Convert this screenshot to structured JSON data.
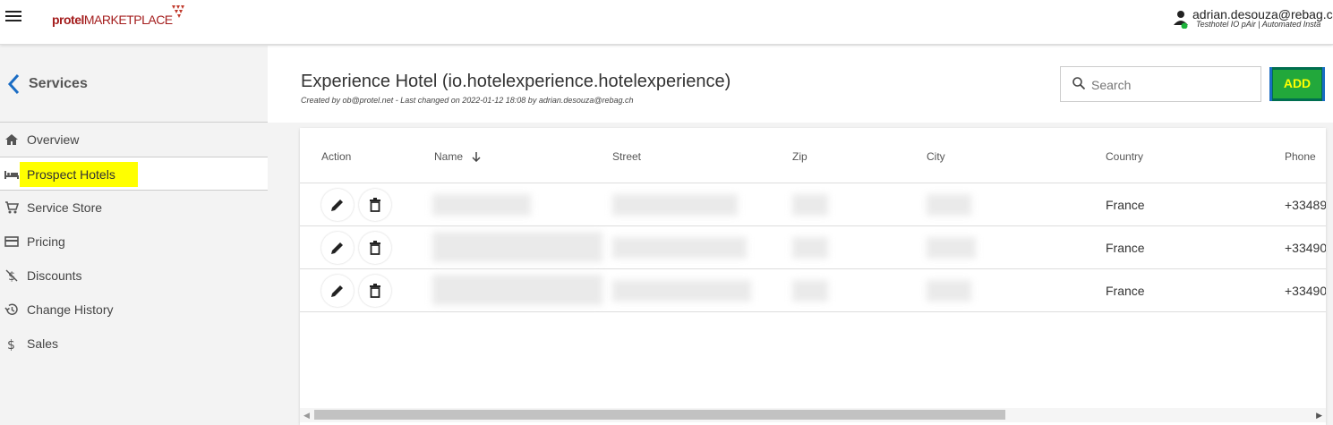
{
  "header": {
    "logo_bold": "protel",
    "logo_rest": "MARKETPLACE",
    "user_name": "adrian.desouza@rebag.ch",
    "user_sub": "Testhotel IO pAir | Automated Insta"
  },
  "sidebar": {
    "title": "Services",
    "items": [
      {
        "label": "Overview",
        "icon": "home-icon"
      },
      {
        "label": "Prospect Hotels",
        "icon": "bed-icon",
        "active": true
      },
      {
        "label": "Service Store",
        "icon": "cart-icon"
      },
      {
        "label": "Pricing",
        "icon": "credit-card-icon"
      },
      {
        "label": "Discounts",
        "icon": "no-dollar-icon"
      },
      {
        "label": "Change History",
        "icon": "history-icon"
      },
      {
        "label": "Sales",
        "icon": "dollar-icon"
      }
    ]
  },
  "main": {
    "title": "Experience Hotel (io.hotelexperience.hotelexperience)",
    "subtitle": "Created by ob@protel.net - Last changed on 2022-01-12 18:08 by adrian.desouza@rebag.ch",
    "search_placeholder": "Search",
    "add_label": "ADD"
  },
  "table": {
    "columns": [
      "Action",
      "Name",
      "Street",
      "Zip",
      "City",
      "Country",
      "Phone"
    ],
    "sort_column": "Name",
    "rows": [
      {
        "country": "France",
        "phone": "+33489"
      },
      {
        "country": "France",
        "phone": "+33490"
      },
      {
        "country": "France",
        "phone": "+33490"
      }
    ]
  },
  "colors": {
    "accent": "#1a6cc4",
    "highlight": "#ffff00",
    "add_button": "#22a83b",
    "brand": "#a41d1d"
  }
}
